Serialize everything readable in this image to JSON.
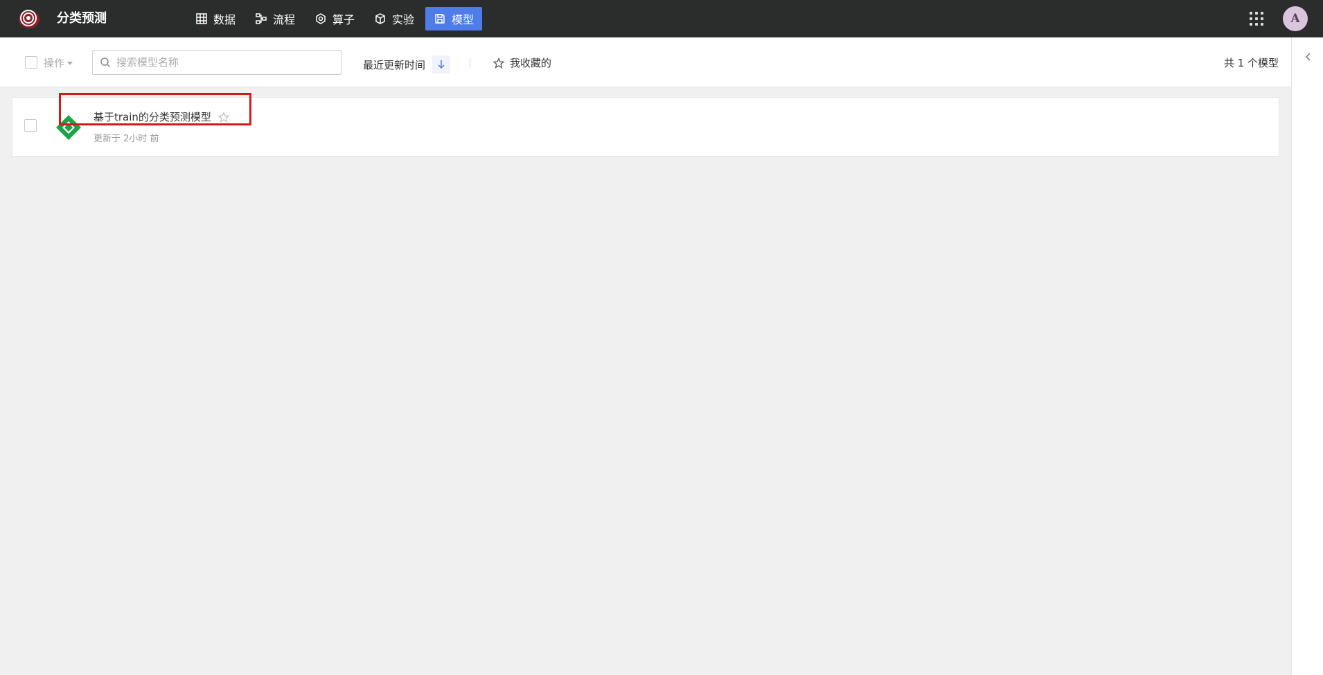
{
  "app": {
    "title": "分类预测",
    "logo_icon": "spiral-logo-icon",
    "accent_color": "#4e7ce8",
    "topbar_color": "#2b2d2d"
  },
  "nav": {
    "items": [
      {
        "label": "数据",
        "icon": "table-icon",
        "active": false
      },
      {
        "label": "流程",
        "icon": "flow-icon",
        "active": false
      },
      {
        "label": "算子",
        "icon": "hexagon-icon",
        "active": false
      },
      {
        "label": "实验",
        "icon": "cube-icon",
        "active": false
      },
      {
        "label": "模型",
        "icon": "save-icon",
        "active": true
      }
    ],
    "apps_icon": "grid-apps-icon",
    "avatar_letter": "A"
  },
  "toolbar": {
    "ops_label": "操作",
    "search_placeholder": "搜索模型名称",
    "sort_label": "最近更新时间",
    "sort_icon": "arrow-down-icon",
    "fav_label": "我收藏的",
    "count_label": "共 1 个模型"
  },
  "models": [
    {
      "name": "基于train的分类预测模型",
      "updated": "更新于 2小时 前",
      "icon": "model-diamond-icon",
      "icon_color": "#1fa34a",
      "starred": false
    }
  ]
}
